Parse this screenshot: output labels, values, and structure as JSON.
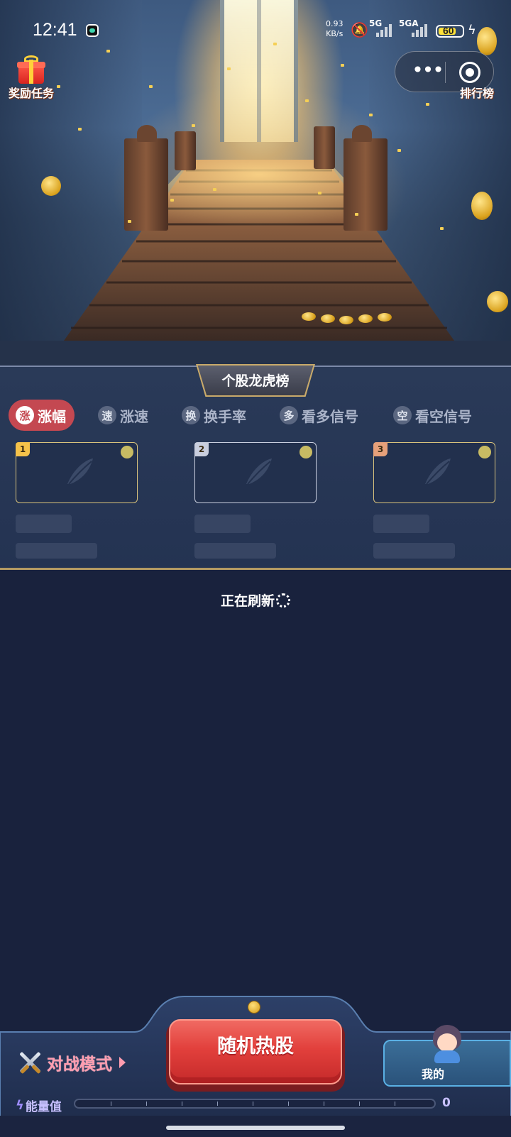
{
  "status_bar": {
    "time": "12:41",
    "net_speed_value": "0.93",
    "net_speed_unit": "KB/s",
    "signal1": "5G",
    "signal2": "5GA",
    "battery": "60"
  },
  "top": {
    "reward_label": "奖励任务",
    "more_glyph": "•••",
    "rank_label": "排行榜"
  },
  "panel": {
    "title": "个股龙虎榜",
    "tabs": [
      {
        "badge": "涨",
        "label": "涨幅",
        "active": true
      },
      {
        "badge": "速",
        "label": "涨速"
      },
      {
        "badge": "换",
        "label": "换手率"
      },
      {
        "badge": "多",
        "label": "看多信号"
      },
      {
        "badge": "空",
        "label": "看空信号"
      }
    ],
    "cards": [
      {
        "rank": "1",
        "rank_color": "#f5c24a"
      },
      {
        "rank": "2",
        "rank_color": "#c9cede"
      },
      {
        "rank": "3",
        "rank_color": "#e6a07a"
      }
    ]
  },
  "refresh_text": "正在刷新",
  "dock": {
    "battle_label": "对战模式",
    "hot_stock_label": "随机热股",
    "mine_label": "我的",
    "energy_label": "能量值",
    "energy_value": "0",
    "energy_fraction": 0
  }
}
